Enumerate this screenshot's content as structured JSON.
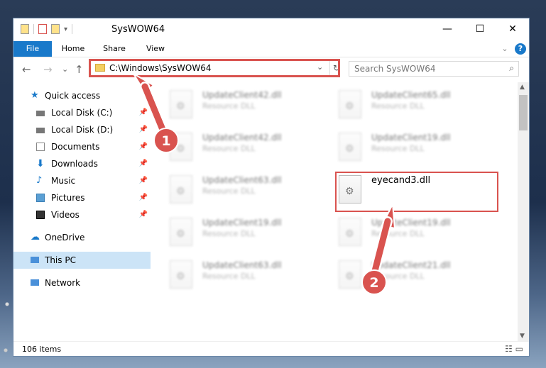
{
  "window": {
    "title": "SysWOW64",
    "controls": {
      "minimize": "—",
      "maximize": "☐",
      "close": "✕"
    }
  },
  "ribbon": {
    "tabs": [
      {
        "label": "File"
      },
      {
        "label": "Home"
      },
      {
        "label": "Share"
      },
      {
        "label": "View"
      }
    ],
    "collapse": "⌄",
    "help": "?"
  },
  "address": {
    "path": "C:\\Windows\\SysWOW64",
    "search_placeholder": "Search SysWOW64"
  },
  "navigation": {
    "back": "←",
    "forward": "→",
    "recent": "⌄",
    "up": "↑",
    "items": [
      {
        "label": "Quick access",
        "icon": "star-icon"
      },
      {
        "label": "Local Disk (C:)",
        "icon": "drive-icon"
      },
      {
        "label": "Local Disk (D:)",
        "icon": "drive-icon"
      },
      {
        "label": "Documents",
        "icon": "documents-icon"
      },
      {
        "label": "Downloads",
        "icon": "downloads-icon"
      },
      {
        "label": "Music",
        "icon": "music-icon"
      },
      {
        "label": "Pictures",
        "icon": "pictures-icon"
      },
      {
        "label": "Videos",
        "icon": "videos-icon"
      },
      {
        "label": "OneDrive",
        "icon": "cloud-icon"
      },
      {
        "label": "This PC",
        "icon": "pc-icon"
      },
      {
        "label": "Network",
        "icon": "network-icon"
      }
    ]
  },
  "files": [
    {
      "name": "UpdateClient42.dll",
      "type": "Resource DLL"
    },
    {
      "name": "UpdateClient65.dll",
      "type": "Resource DLL"
    },
    {
      "name": "UpdateClient42.dll",
      "type": "Resource DLL"
    },
    {
      "name": "UpdateClient19.dll",
      "type": "Resource DLL"
    },
    {
      "name": "UpdateClient63.dll",
      "type": "Resource DLL"
    },
    {
      "name": "eyecand3.dll",
      "type": ""
    },
    {
      "name": "UpdateClient19.dll",
      "type": "Resource DLL"
    },
    {
      "name": "UpdateClient19.dll",
      "type": "Resource DLL"
    },
    {
      "name": "UpdateClient63.dll",
      "type": "Resource DLL"
    },
    {
      "name": "UpdateClient21.dll",
      "type": "Resource DLL"
    }
  ],
  "status": {
    "count": "106 items"
  },
  "annotations": {
    "step1": "1",
    "step2": "2"
  },
  "colors": {
    "accent": "#1979ca",
    "highlight": "#d9534f"
  }
}
